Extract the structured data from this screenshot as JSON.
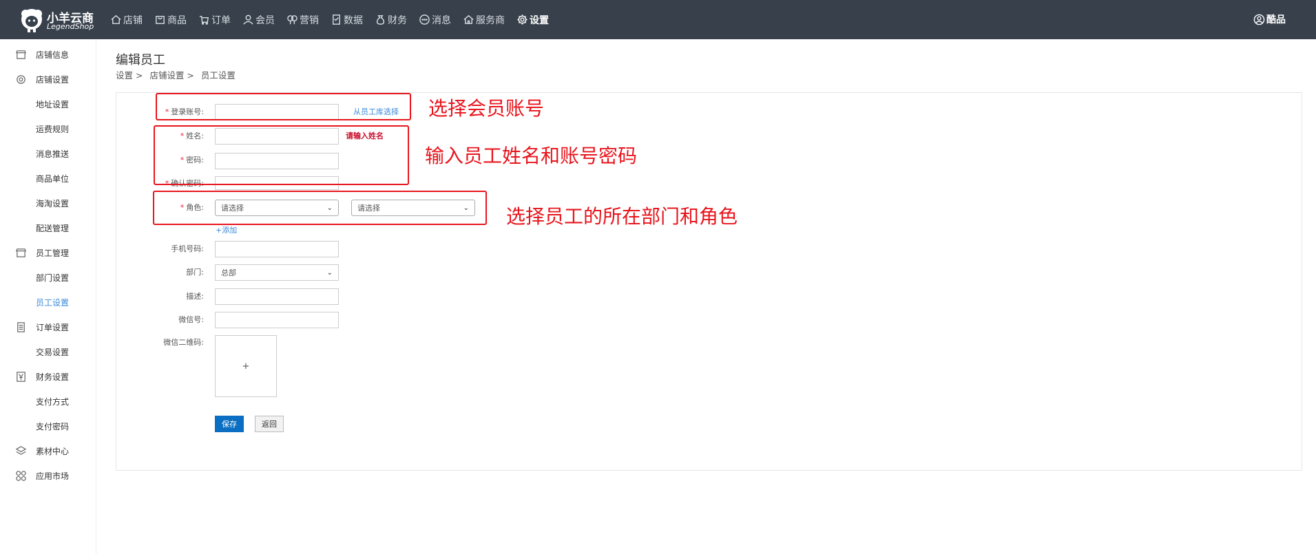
{
  "brand": {
    "name_cn": "小羊云商",
    "name_en": "LegendShop"
  },
  "nav": [
    {
      "label": "店铺",
      "icon": "home-icon"
    },
    {
      "label": "商品",
      "icon": "bag-icon"
    },
    {
      "label": "订单",
      "icon": "cart-icon"
    },
    {
      "label": "会员",
      "icon": "person-icon"
    },
    {
      "label": "营销",
      "icon": "balloon-icon"
    },
    {
      "label": "数据",
      "icon": "document-icon"
    },
    {
      "label": "财务",
      "icon": "money-bag-icon"
    },
    {
      "label": "消息",
      "icon": "chat-icon"
    },
    {
      "label": "服务商",
      "icon": "house-icon"
    },
    {
      "label": "设置",
      "icon": "gear-icon"
    }
  ],
  "user": {
    "name": "酷品"
  },
  "sidebar": [
    {
      "label": "店铺信息",
      "type": "group",
      "icon": "store-icon"
    },
    {
      "label": "店铺设置",
      "type": "group",
      "icon": "gear-icon"
    },
    {
      "label": "地址设置",
      "type": "sub"
    },
    {
      "label": "运费规则",
      "type": "sub"
    },
    {
      "label": "消息推送",
      "type": "sub"
    },
    {
      "label": "商品单位",
      "type": "sub"
    },
    {
      "label": "海淘设置",
      "type": "sub"
    },
    {
      "label": "配送管理",
      "type": "sub"
    },
    {
      "label": "员工管理",
      "type": "group",
      "icon": "store-icon"
    },
    {
      "label": "部门设置",
      "type": "sub"
    },
    {
      "label": "员工设置",
      "type": "sub"
    },
    {
      "label": "订单设置",
      "type": "group",
      "icon": "list-icon"
    },
    {
      "label": "交易设置",
      "type": "sub"
    },
    {
      "label": "财务设置",
      "type": "group",
      "icon": "yen-icon"
    },
    {
      "label": "支付方式",
      "type": "sub"
    },
    {
      "label": "支付密码",
      "type": "sub"
    },
    {
      "label": "素材中心",
      "type": "group",
      "icon": "layers-icon"
    },
    {
      "label": "应用市场",
      "type": "group",
      "icon": "apps-icon"
    }
  ],
  "page": {
    "title": "编辑员工",
    "breadcrumb": [
      "设置 >",
      "店铺设置 >",
      "员工设置"
    ]
  },
  "form": {
    "required_mark": "*",
    "login_account": {
      "label": "登录账号:",
      "value": "",
      "pick_link": "从员工库选择"
    },
    "name": {
      "label": "姓名:",
      "value": "",
      "error": "请输入姓名"
    },
    "password": {
      "label": "密码:",
      "value": ""
    },
    "confirm_password": {
      "label": "确认密码:",
      "value": ""
    },
    "role": {
      "label": "角色:",
      "select1": "请选择",
      "select2": "请选择",
      "add_link": "+添加"
    },
    "phone": {
      "label": "手机号码:",
      "value": ""
    },
    "department": {
      "label": "部门:",
      "value": "总部"
    },
    "description": {
      "label": "描述:",
      "value": ""
    },
    "wechat": {
      "label": "微信号:",
      "value": ""
    },
    "wechat_qr": {
      "label": "微信二维码:",
      "upload_glyph": "+"
    },
    "save_label": "保存",
    "back_label": "返回"
  },
  "annotations": {
    "select_account": "选择会员账号",
    "enter_name_password": "输入员工姓名和账号密码",
    "select_dept_role": "选择员工的所在部门和角色"
  },
  "colors": {
    "topbar": "#37404b",
    "annotation": "#e8141c",
    "primary": "#0a6fc2",
    "link": "#3b8ad9"
  }
}
